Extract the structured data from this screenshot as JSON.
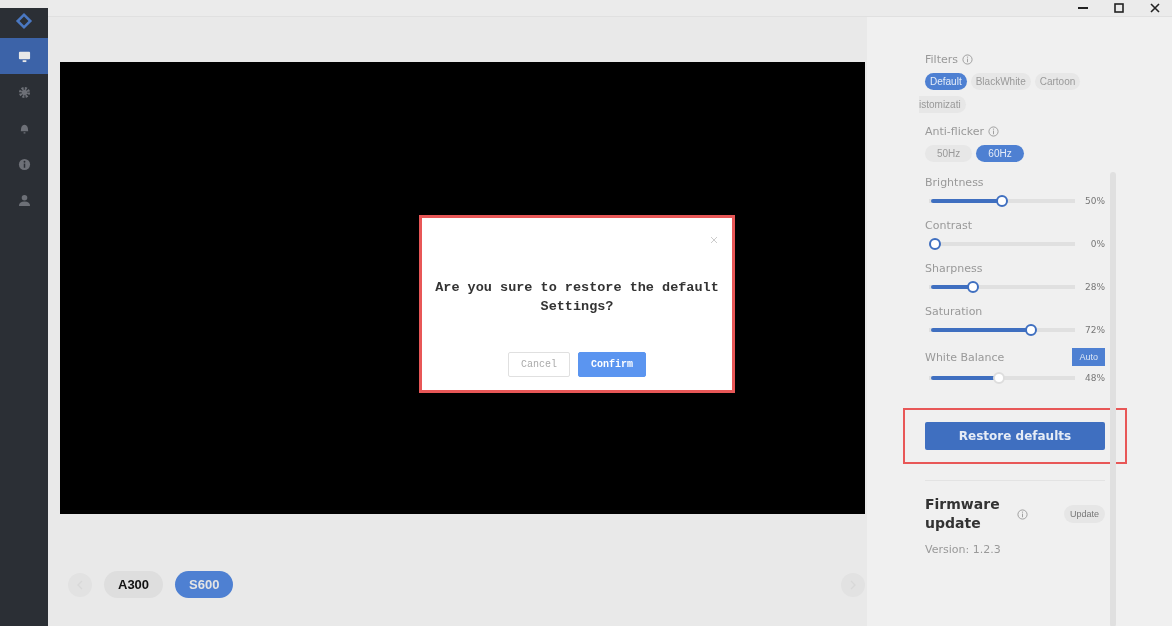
{
  "sidebar": {
    "items": [
      {
        "selected": true
      },
      {
        "selected": false
      },
      {
        "selected": false
      },
      {
        "selected": false
      },
      {
        "selected": false
      }
    ]
  },
  "devices": [
    {
      "label": "A300",
      "selected": false
    },
    {
      "label": "S600",
      "selected": true
    }
  ],
  "dialog": {
    "message": "Are you sure to restore the default Settings?",
    "buttons": [
      {
        "label": "Cancel",
        "kind": "secondary"
      },
      {
        "label": "Confirm",
        "kind": "primary"
      }
    ]
  },
  "settings": {
    "filters": {
      "label": "Filters",
      "options": [
        {
          "label": "Default",
          "selected": true
        },
        {
          "label": "BlackWhite",
          "selected": false
        },
        {
          "label": "Cartoon",
          "selected": false
        },
        {
          "label": "istomizati",
          "selected": false
        }
      ]
    },
    "anti_flicker": {
      "label": "Anti-flicker",
      "options": [
        {
          "label": "50Hz",
          "selected": false
        },
        {
          "label": "60Hz",
          "selected": true
        }
      ]
    },
    "sliders": [
      {
        "name": "Brightness",
        "level": 0.5,
        "reading": "50%",
        "disabled": false
      },
      {
        "name": "Contrast",
        "level": 0,
        "reading": "0%",
        "disabled": false
      },
      {
        "name": "Sharpness",
        "level": 0.28,
        "reading": "28%",
        "disabled": false
      },
      {
        "name": "Saturation",
        "level": 0.72,
        "reading": "72%",
        "disabled": false
      },
      {
        "name": "White Balance",
        "level": 0.48,
        "reading": "48%",
        "disabled": true,
        "auto_button": "Auto"
      }
    ],
    "restore_button": "Restore defaults",
    "firmware": {
      "title": "Firmware update",
      "button": "Update",
      "version": "Version: 1.2.3"
    }
  }
}
